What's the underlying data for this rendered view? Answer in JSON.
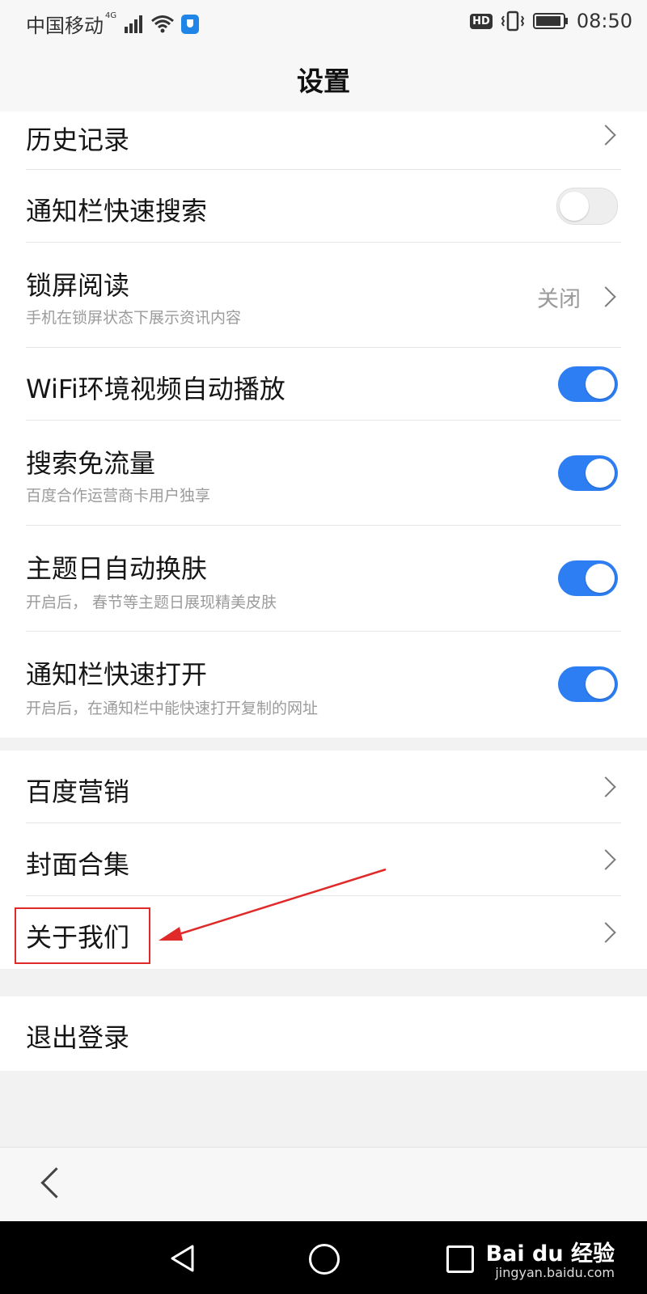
{
  "status_bar": {
    "carrier": "中国移动",
    "network": "4G",
    "hd_label": "HD",
    "time": "08:50"
  },
  "header": {
    "title": "设置"
  },
  "settings_group_1": [
    {
      "label": "历史记录",
      "type": "link"
    },
    {
      "label": "通知栏快速搜索",
      "type": "toggle",
      "on": false
    },
    {
      "label": "锁屏阅读",
      "subtitle": "手机在锁屏状态下展示资讯内容",
      "value": "关闭",
      "type": "link"
    },
    {
      "label": "WiFi环境视频自动播放",
      "type": "toggle",
      "on": true
    },
    {
      "label": "搜索免流量",
      "subtitle": "百度合作运营商卡用户独享",
      "type": "toggle",
      "on": true
    },
    {
      "label": "主题日自动换肤",
      "subtitle": "开启后， 春节等主题日展现精美皮肤",
      "type": "toggle",
      "on": true
    },
    {
      "label": "通知栏快速打开",
      "subtitle": "开启后，在通知栏中能快速打开复制的网址",
      "type": "toggle",
      "on": true
    }
  ],
  "settings_group_2": [
    {
      "label": "百度营销"
    },
    {
      "label": "封面合集"
    },
    {
      "label": "关于我们"
    }
  ],
  "logout_label": "退出登录",
  "watermark": {
    "brand": "Bai du 经验",
    "url": "jingyan.baidu.com"
  },
  "colors": {
    "accent_blue": "#2d7ef3",
    "annotation_red": "#e02a2a"
  },
  "icons": [
    "signal-icon",
    "wifi-icon",
    "shield-icon",
    "vibrate-icon",
    "battery-icon",
    "chevron-right-icon",
    "back-icon",
    "nav-back-icon",
    "nav-home-icon",
    "nav-recent-icon"
  ]
}
